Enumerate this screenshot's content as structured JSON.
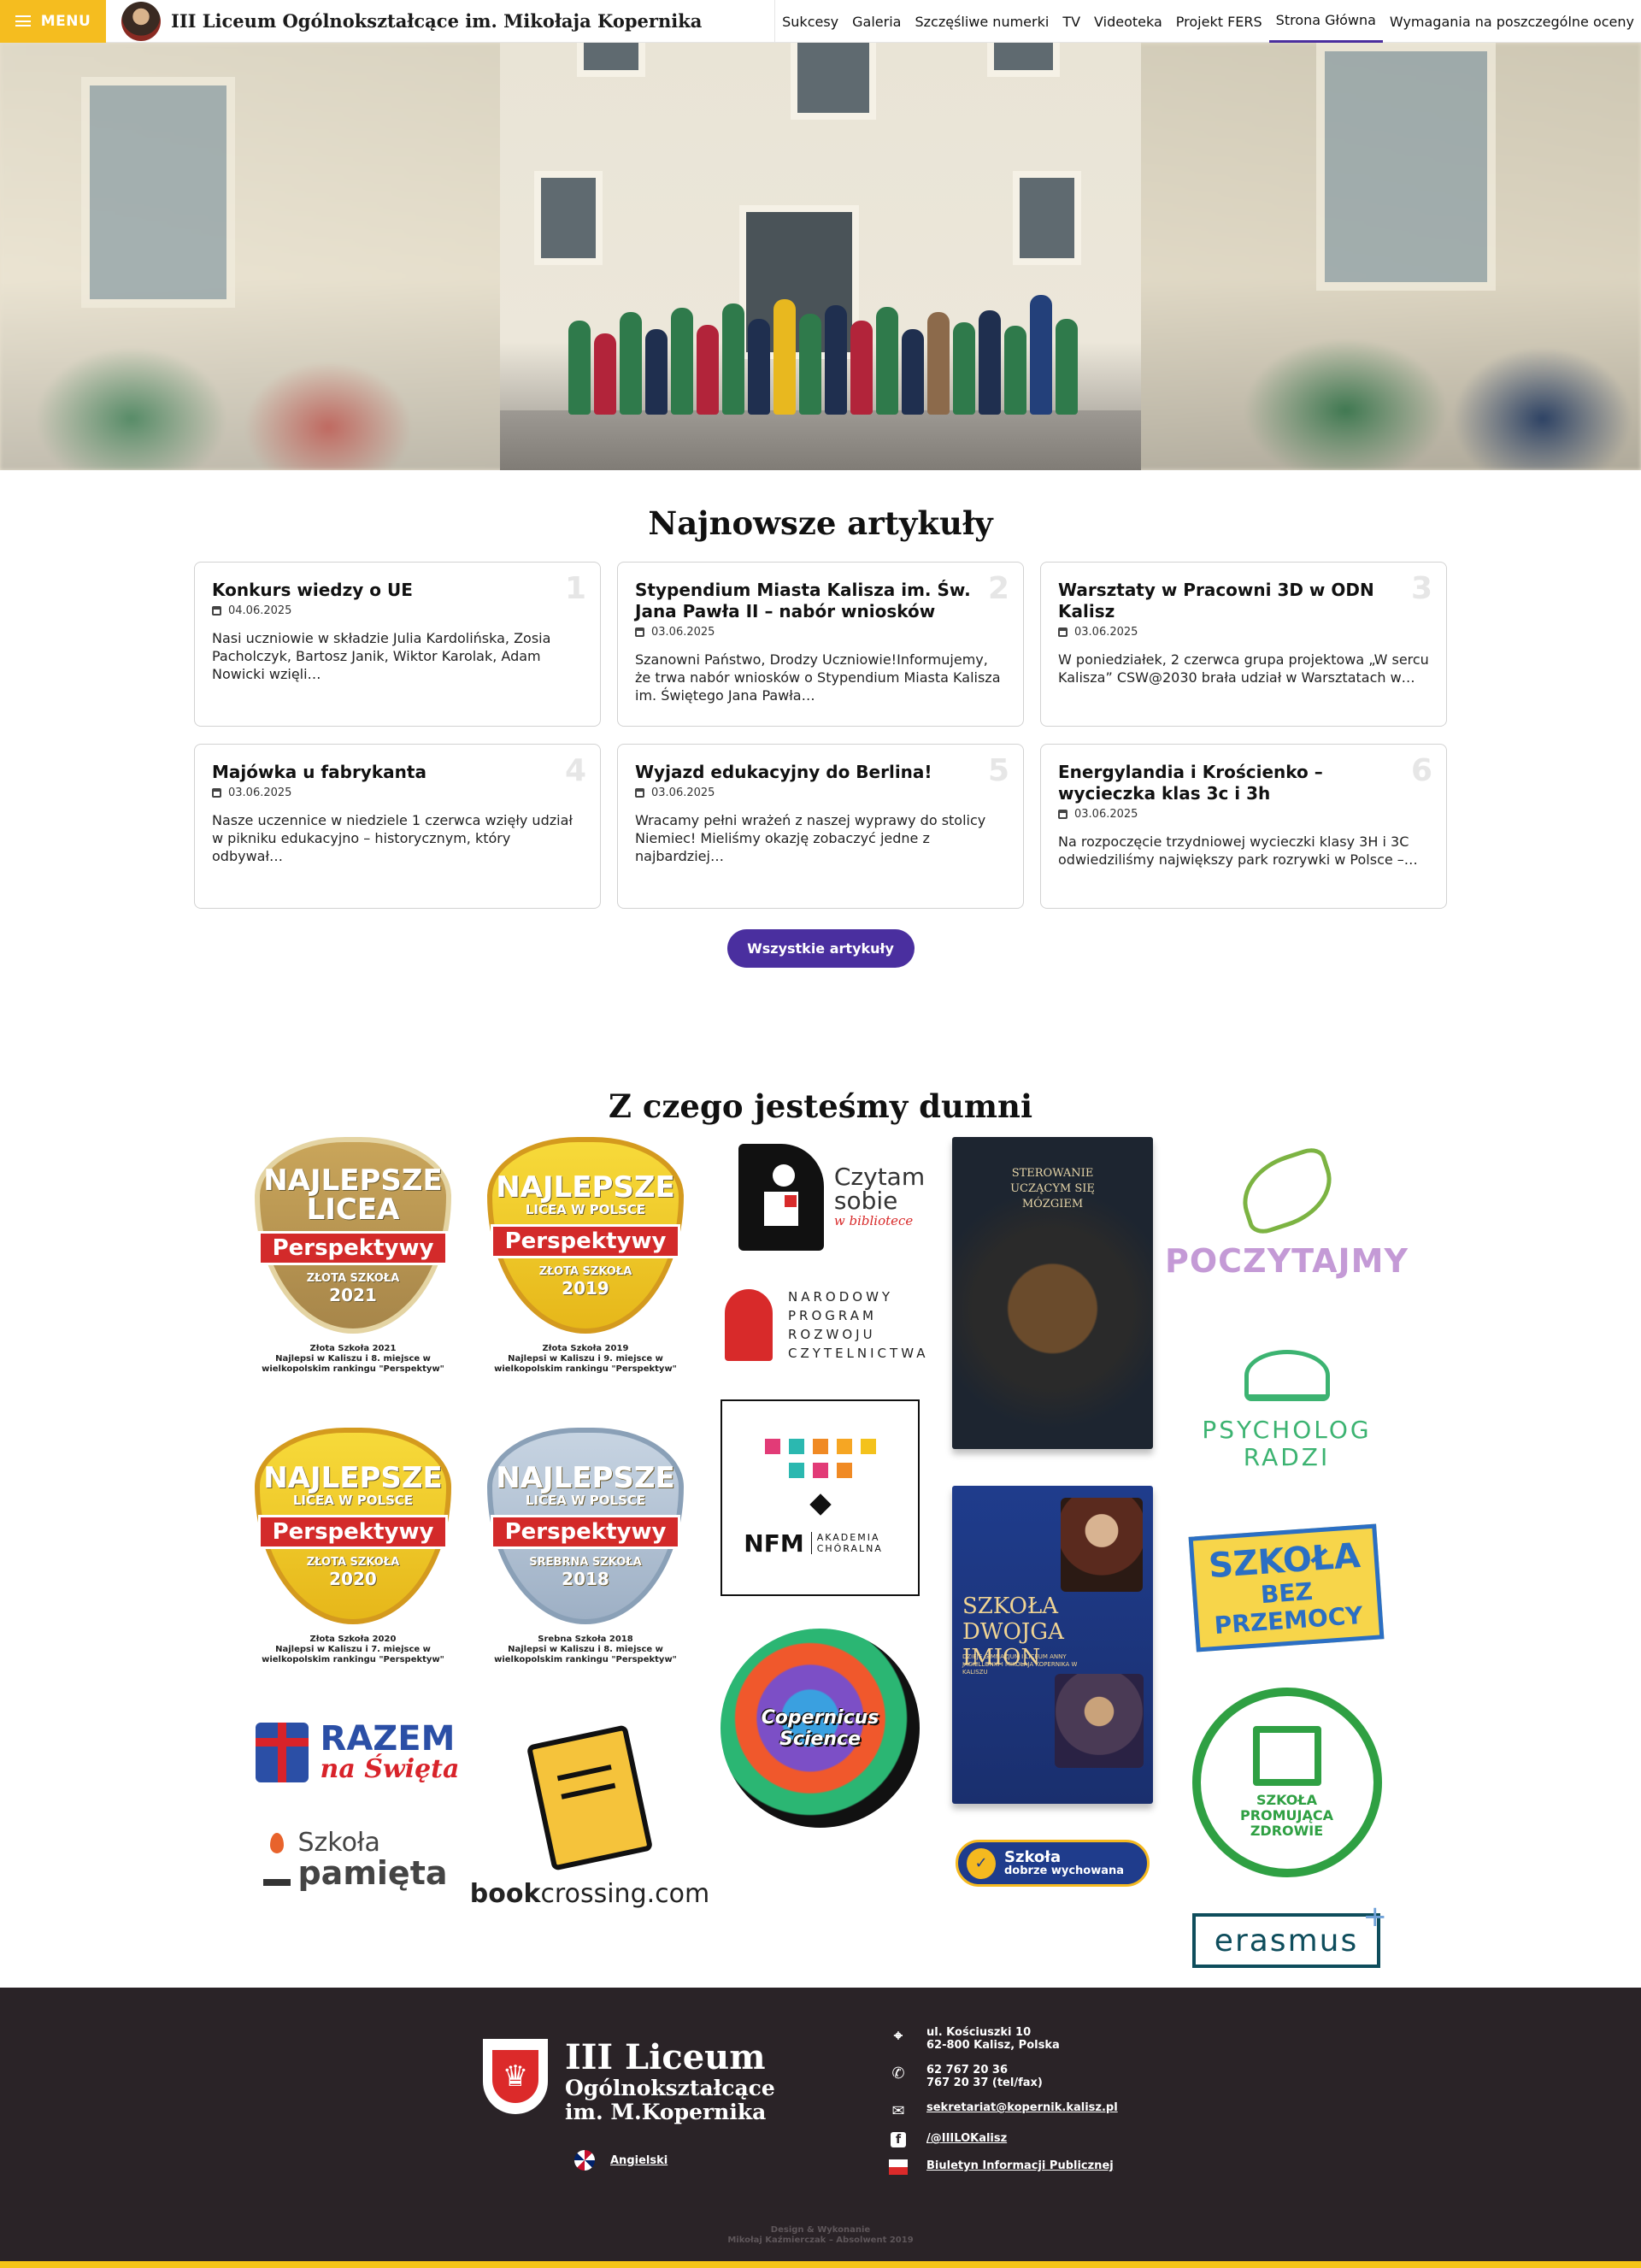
{
  "header": {
    "menu_label": "MENU",
    "school_name": "III Liceum Ogólnokształcące im. Mikołaja Kopernika",
    "nav": [
      {
        "label": "Sukcesy",
        "active": false
      },
      {
        "label": "Galeria",
        "active": false
      },
      {
        "label": "Szczęśliwe numerki",
        "active": false
      },
      {
        "label": "TV",
        "active": false
      },
      {
        "label": "Videoteka",
        "active": false
      },
      {
        "label": "Projekt FERS",
        "active": false
      },
      {
        "label": "Strona Główna",
        "active": true
      },
      {
        "label": "Wymagania na poszczególne oceny",
        "active": false
      }
    ]
  },
  "articles": {
    "title": "Najnowsze artykuły",
    "items": [
      {
        "num": "1",
        "title": "Konkurs wiedzy o UE",
        "date": "04.06.2025",
        "excerpt": "Nasi uczniowie w składzie Julia Kardolińska, Zosia Pacholczyk, Bartosz Janik, Wiktor Karolak, Adam Nowicki wzięli…"
      },
      {
        "num": "2",
        "title": "Stypendium Miasta Kalisza im. Św. Jana Pawła II – nabór wniosków",
        "date": "03.06.2025",
        "excerpt": "Szanowni Państwo, Drodzy Uczniowie!Informujemy, że trwa nabór wniosków o Stypendium Miasta Kalisza im. Świętego Jana Pawła…"
      },
      {
        "num": "3",
        "title": "Warsztaty w Pracowni 3D w ODN Kalisz",
        "date": "03.06.2025",
        "excerpt": "W poniedziałek, 2 czerwca grupa projektowa „W sercu Kalisza” CSW@2030 brała udział w Warsztatach w…"
      },
      {
        "num": "4",
        "title": "Majówka u fabrykanta",
        "date": "03.06.2025",
        "excerpt": "Nasze uczennice w niedziele 1 czerwca wzięły udział w pikniku edukacyjno – historycznym, który odbywał…"
      },
      {
        "num": "5",
        "title": "Wyjazd edukacyjny do Berlina!",
        "date": "03.06.2025",
        "excerpt": "Wracamy pełni wrażeń z naszej wyprawy do stolicy Niemiec! Mieliśmy okazję zobaczyć jedne z najbardziej…"
      },
      {
        "num": "6",
        "title": "Energylandia i Krościenko – wycieczka klas 3c i 3h",
        "date": "03.06.2025",
        "excerpt": "Na rozpoczęcie trzydniowej wycieczki klasy 3H i 3C odwiedziliśmy największy park rozrywki w Polsce –…"
      }
    ],
    "all_button": "Wszystkie artykuły"
  },
  "proud": {
    "title": "Z czego jesteśmy dumni",
    "badges": [
      {
        "line1": "NAJLEPSZE",
        "line2": "LICEA",
        "ribbon": "Perspektywy",
        "line3": "ZŁOTA SZKOŁA",
        "year": "2021",
        "caption1": "Złota Szkoła 2021",
        "caption2": "Najlepsi w Kaliszu i 8. miejsce w wielkopolskim rankingu \"Perspektyw\""
      },
      {
        "line1": "NAJLEPSZE",
        "line2": "LICEA W POLSCE",
        "ribbon": "Perspektywy",
        "line3": "ZŁOTA SZKOŁA",
        "year": "2019",
        "caption1": "Złota Szkoła 2019",
        "caption2": "Najlepsi w Kaliszu i 9. miejsce w wielkopolskim rankingu \"Perspektyw\""
      },
      {
        "line1": "NAJLEPSZE",
        "line2": "LICEA W POLSCE",
        "ribbon": "Perspektywy",
        "line3": "ZŁOTA SZKOŁA",
        "year": "2020",
        "caption1": "Złota Szkoła 2020",
        "caption2": "Najlepsi w Kaliszu i 7. miejsce w wielkopolskim rankingu \"Perspektyw\""
      },
      {
        "line1": "NAJLEPSZE",
        "line2": "LICEA W POLSCE",
        "ribbon": "Perspektywy",
        "line3": "SREBRNA SZKOŁA",
        "year": "2018",
        "caption1": "Srebna Szkoła 2018",
        "caption2": "Najlepsi w Kaliszu i 8. miejsce w wielkopolskim rankingu \"Perspektyw\""
      }
    ],
    "logos": {
      "razem_a": "RAZEM",
      "razem_b": "na Święta",
      "pamieta_a": "Szkoła",
      "pamieta_b": "pamięta",
      "bookcrossing_a": "book",
      "bookcrossing_b": "crossing.com",
      "czytam_a": "Czytam",
      "czytam_b": "sobie",
      "czytam_c": "w bibliotece",
      "npr": "NARODOWY PROGRAM ROZWOJU CZYTELNICTWA",
      "nfm": "NFM",
      "nfm_sub": "AKADEMIA CHÓRALNA",
      "copernicus": "Copernicus Science",
      "book1": "STEROWANIE UCZĄCYM SIĘ MÓZGIEM",
      "book2": "SZKOŁA DWOJGA IMION",
      "book2_sub": "DZIEJE GIMNAZJUM I LICEUM ANNY JAGIELLONKI I MIKOŁAJA KOPERNIKA W KALISZU",
      "dobrze_a": "Szkoła",
      "dobrze_b": "dobrze wychowana",
      "poczytajmy": "POCZYTAJMY",
      "psycholog_a": "PSYCHOLOG",
      "psycholog_b": "RADZI",
      "przemoc_a": "SZKOŁA",
      "przemoc_b": "BEZ PRZEMOCY",
      "zdrowie": "SZKOŁA PROMUJĄCA ZDROWIE",
      "erasmus": "erasmus"
    }
  },
  "footer": {
    "name_a": "III Liceum",
    "name_b": "Ogólnokształcące",
    "name_c": "im. M.Kopernika",
    "language": "Angielski",
    "address_1": "ul. Kościuszki 10",
    "address_2": "62-800 Kalisz, Polska",
    "phone_1": "62 767 20 36",
    "phone_2": "767 20 37 (tel/fax)",
    "email": "sekretariat@kopernik.kalisz.pl",
    "facebook": "/@IIILOKalisz",
    "bip": "Biuletyn Informacji Publicznej",
    "credits_1": "Design & Wykonanie",
    "credits_2": "Mikołaj Kaźmierczak – Absolwent 2019"
  }
}
